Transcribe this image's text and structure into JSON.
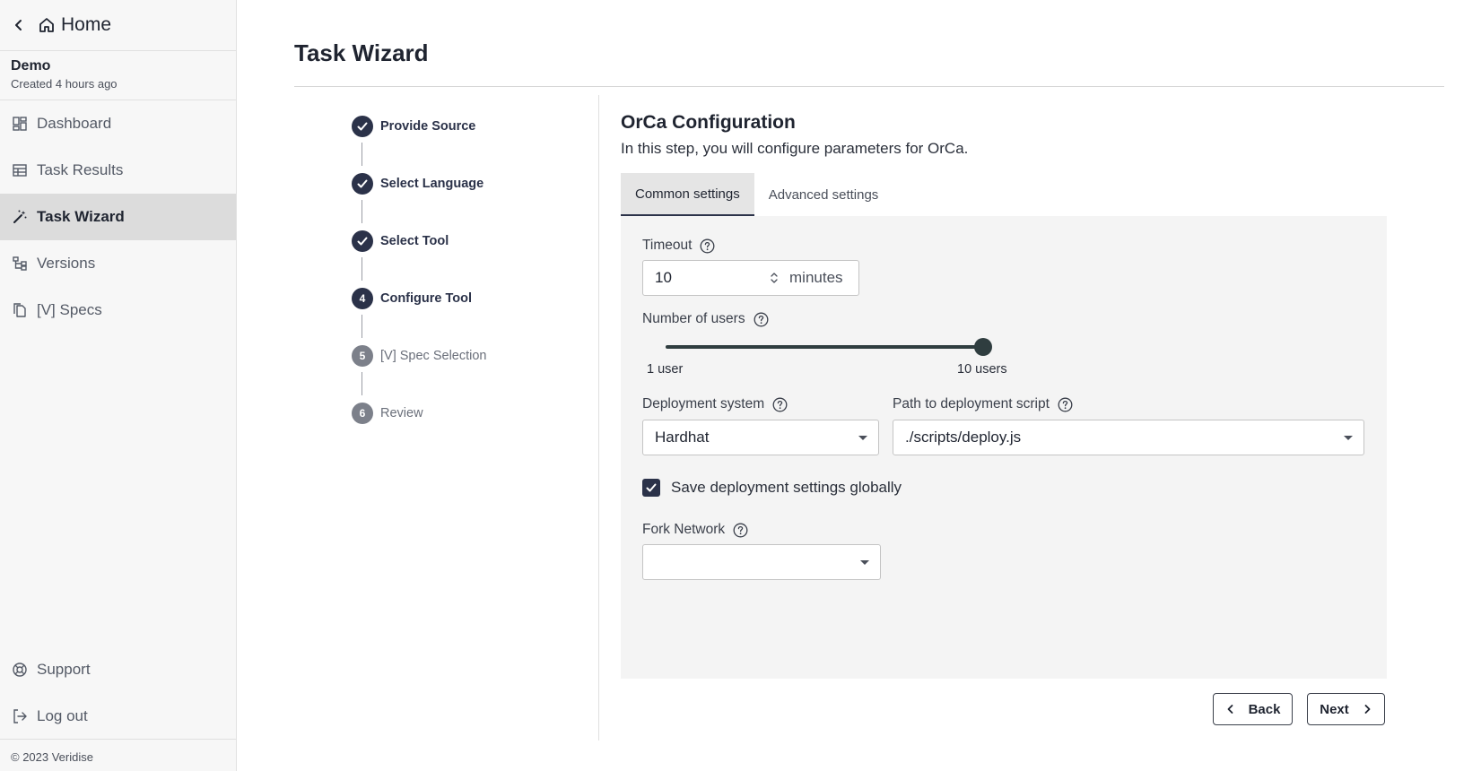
{
  "sidebar": {
    "home_label": "Home",
    "project": {
      "name": "Demo",
      "created": "Created 4 hours ago"
    },
    "items": [
      {
        "label": "Dashboard",
        "icon": "dashboard-icon"
      },
      {
        "label": "Task Results",
        "icon": "table-icon"
      },
      {
        "label": "Task Wizard",
        "icon": "wand-icon",
        "active": true
      },
      {
        "label": "Versions",
        "icon": "tree-icon"
      },
      {
        "label": "[V] Specs",
        "icon": "files-icon"
      }
    ],
    "bottom_items": [
      {
        "label": "Support",
        "icon": "lifebuoy-icon"
      },
      {
        "label": "Log out",
        "icon": "logout-icon"
      }
    ],
    "footer": "© 2023 Veridise"
  },
  "page": {
    "title": "Task Wizard"
  },
  "steps": [
    {
      "number": "1",
      "label": "Provide Source",
      "status": "done"
    },
    {
      "number": "2",
      "label": "Select Language",
      "status": "done"
    },
    {
      "number": "3",
      "label": "Select Tool",
      "status": "done"
    },
    {
      "number": "4",
      "label": "Configure Tool",
      "status": "current"
    },
    {
      "number": "5",
      "label": "[V] Spec Selection",
      "status": "pending"
    },
    {
      "number": "6",
      "label": "Review",
      "status": "pending"
    }
  ],
  "config": {
    "title": "OrCa Configuration",
    "description": "In this step, you will configure parameters for OrCa.",
    "tabs": [
      {
        "label": "Common settings",
        "active": true
      },
      {
        "label": "Advanced settings",
        "active": false
      }
    ],
    "timeout": {
      "label": "Timeout",
      "value": "10",
      "unit": "minutes"
    },
    "users": {
      "label": "Number of users",
      "min_label": "1 user",
      "max_label": "10 users",
      "min": 1,
      "max": 10,
      "value": 10
    },
    "deployment_system": {
      "label": "Deployment system",
      "value": "Hardhat"
    },
    "deployment_script": {
      "label": "Path to deployment script",
      "value": "./scripts/deploy.js"
    },
    "save_globally": {
      "label": "Save deployment settings globally",
      "checked": true
    },
    "fork_network": {
      "label": "Fork Network",
      "value": ""
    }
  },
  "buttons": {
    "back": "Back",
    "next": "Next"
  },
  "colors": {
    "primary": "#2b3249",
    "panel": "#f4f4f4",
    "sidebar_active": "#dcdcdc"
  }
}
